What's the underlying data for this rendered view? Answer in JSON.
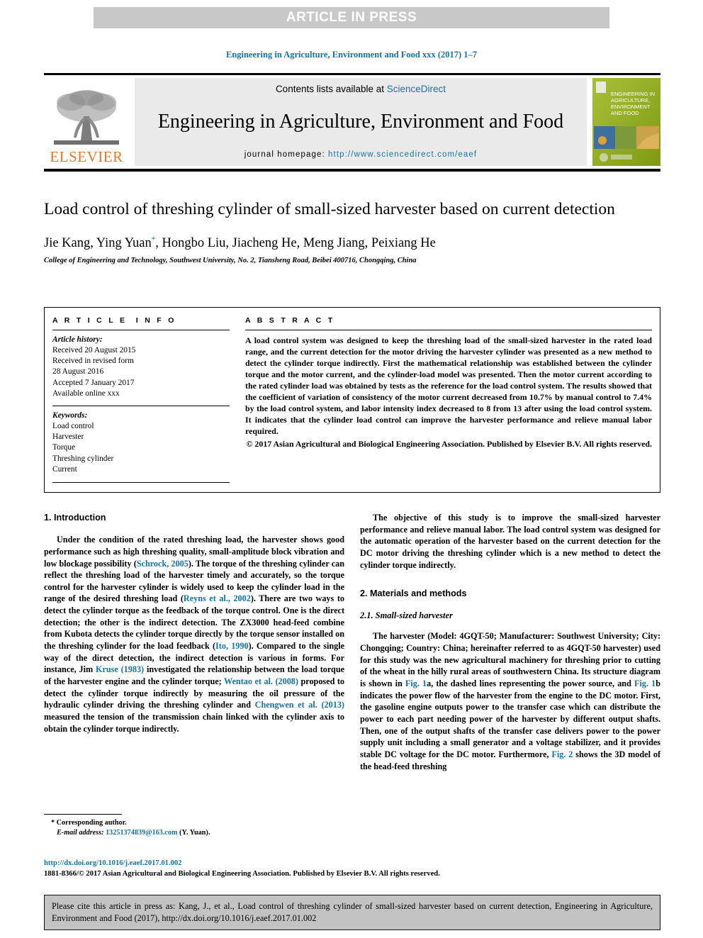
{
  "banner": {
    "label": "ARTICLE IN PRESS"
  },
  "running_head": {
    "text": "Engineering in Agriculture, Environment and Food xxx (2017) 1–7"
  },
  "masthead": {
    "contents_prefix": "Contents lists available at ",
    "contents_link": "ScienceDirect",
    "journal_title": "Engineering in Agriculture, Environment and Food",
    "homepage_prefix": "journal homepage: ",
    "homepage_url": "http://www.sciencedirect.com/eaef",
    "publisher_logo_text": "ELSEVIER",
    "cover_title": "ENGINEERING IN AGRICULTURE, ENVIRONMENT AND FOOD"
  },
  "article": {
    "title": "Load control of threshing cylinder of small-sized harvester based on current detection",
    "authors": "Jie Kang, Ying Yuan",
    "authors_rest": ", Hongbo Liu, Jiacheng He, Meng Jiang, Peixiang He",
    "author_marker": "*",
    "affiliation": "College of Engineering and Technology, Southwest University, No. 2, Tiansheng Road, Beibei 400716, Chongqing, China"
  },
  "info": {
    "heading": "ARTICLE INFO",
    "history_label": "Article history:",
    "history_lines": [
      "Received 20 August 2015",
      "Received in revised form",
      "28 August 2016",
      "Accepted 7 January 2017",
      "Available online xxx"
    ],
    "keywords_label": "Keywords:",
    "keywords": [
      "Load control",
      "Harvester",
      "Torque",
      "Threshing cylinder",
      "Current"
    ]
  },
  "abstract": {
    "heading": "ABSTRACT",
    "body": "A load control system was designed to keep the threshing load of the small-sized harvester in the rated load range, and the current detection for the motor driving the harvester cylinder was presented as a new method to detect the cylinder torque indirectly. First the mathematical relationship was established between the cylinder torque and the motor current, and the cylinder-load model was presented. Then the motor current according to the rated cylinder load was obtained by tests as the reference for the load control system. The results showed that the coefficient of variation of consistency of the motor current decreased from 10.7% by manual control to 7.4% by the load control system, and labor intensity index decreased to 8 from 13 after using the load control system. It indicates that the cylinder load control can improve the harvester performance and relieve manual labor required.",
    "copyright": "© 2017 Asian Agricultural and Biological Engineering Association. Published by Elsevier B.V. All rights reserved."
  },
  "body": {
    "section1_heading": "1. Introduction",
    "p1_a": "Under the condition of the rated threshing load, the harvester shows good performance such as high threshing quality, small-amplitude block vibration and low blockage possibility (",
    "p1_ref1": "Schrock, 2005",
    "p1_b": "). The torque of the threshing cylinder can reflect the threshing load of the harvester timely and accurately, so the torque control for the harvester cylinder is widely used to keep the cylinder load in the range of the desired threshing load (",
    "p1_ref2": "Reyns et al., 2002",
    "p1_c": "). There are two ways to detect the cylinder torque as the feedback of the torque control. One is the direct detection; the other is the indirect detection. The ZX3000 head-feed combine from Kubota detects the cylinder torque directly by the torque sensor installed on the threshing cylinder for the load feedback (",
    "p1_ref3": "Ito, 1990",
    "p1_d": "). Compared to the single way of the direct detection, the indirect detection is various in forms. For instance, Jim ",
    "p1_ref4": "Kruse (1983)",
    "p1_e": " investigated the relationship between the load torque of the harvester engine and the cylinder torque; ",
    "p1_ref5": "Wentao et al. (2008)",
    "p1_f": " proposed to detect the cylinder torque indirectly by measuring the oil pressure of the hydraulic cylinder driving the threshing cylinder and ",
    "p1_ref6": "Chengwen et al. (2013)",
    "p1_g": " measured the tension of the transmission chain linked with the cylinder axis to obtain the cylinder torque indirectly.",
    "p2": "The objective of this study is to improve the small-sized harvester performance and relieve manual labor. The load control system was designed for the automatic operation of the harvester based on the current detection for the DC motor driving the threshing cylinder which is a new method to detect the cylinder torque indirectly.",
    "section2_heading": "2. Materials and methods",
    "section21_heading": "2.1. Small-sized harvester",
    "p3_a": "The harvester (Model: 4GQT-50; Manufacturer: Southwest University; City: Chongqing; Country: China; hereinafter referred to as 4GQT-50 harvester) used for this study was the new agricultural machinery for threshing prior to cutting of the wheat in the hilly rural areas of southwestern China. Its structure diagram is shown in ",
    "p3_ref1": "Fig. 1",
    "p3_b": "a, the dashed lines representing the power source, and ",
    "p3_ref2": "Fig. 1",
    "p3_c": "b indicates the power flow of the harvester from the engine to the DC motor. First, the gasoline engine outputs power to the transfer case which can distribute the power to each part needing power of the harvester by different output shafts. Then, one of the output shafts of the transfer case delivers power to the power supply unit including a small generator and a voltage stabilizer, and it provides stable DC voltage for the DC motor. Furthermore, ",
    "p3_ref3": "Fig. 2",
    "p3_d": " shows the 3D model of the head-feed threshing"
  },
  "footnote": {
    "marker": "*",
    "corresponding": "Corresponding author.",
    "email_label": "E-mail address:",
    "email": "13251374839@163.com",
    "email_suffix": "(Y. Yuan)."
  },
  "doi": {
    "url": "http://dx.doi.org/10.1016/j.eaef.2017.01.002",
    "issn_line": "1881-8366/© 2017 Asian Agricultural and Biological Engineering Association. Published by Elsevier B.V. All rights reserved."
  },
  "cite_box": {
    "text": "Please cite this article in press as: Kang, J., et al., Load control of threshing cylinder of small-sized harvester based on current detection, Engineering in Agriculture, Environment and Food (2017), http://dx.doi.org/10.1016/j.eaef.2017.01.002"
  },
  "colors": {
    "link": "#1573a8",
    "elsevier_orange": "#e87722",
    "banner_gray": "#c8c8c8",
    "masthead_gray": "#eaeaea",
    "cite_gray": "#c3c3c3"
  }
}
